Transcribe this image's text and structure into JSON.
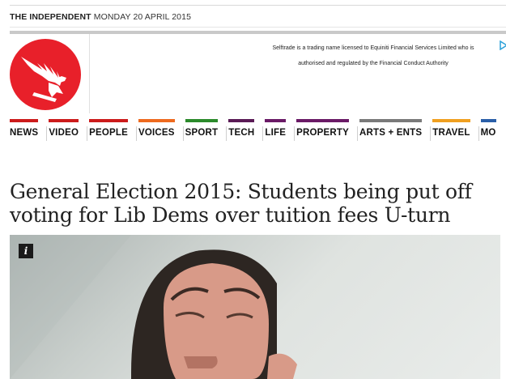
{
  "header": {
    "brand": "THE INDEPENDENT",
    "date": "MONDAY 20 APRIL 2015"
  },
  "logo": {
    "icon": "eagle-icon",
    "color": "#e8202a"
  },
  "advert": {
    "line1": "Selftrade is a trading name licensed to Equiniti Financial Services Limited who is",
    "line2": "authorised and regulated by the Financial Conduct Authority",
    "icon": "adchoices-icon"
  },
  "nav": {
    "items": [
      {
        "label": "NEWS",
        "color": "#cc1b1b"
      },
      {
        "label": "VIDEO",
        "color": "#cc1b1b"
      },
      {
        "label": "PEOPLE",
        "color": "#cc1b1b"
      },
      {
        "label": "VOICES",
        "color": "#ee6a1f"
      },
      {
        "label": "SPORT",
        "color": "#2b8a2b"
      },
      {
        "label": "TECH",
        "color": "#5a1a55"
      },
      {
        "label": "LIFE",
        "color": "#6a1a66"
      },
      {
        "label": "PROPERTY",
        "color": "#6a1a66"
      },
      {
        "label": "ARTS + ENTS",
        "color": "#7a7a7a"
      },
      {
        "label": "TRAVEL",
        "color": "#f0a020"
      },
      {
        "label": "MO",
        "color": "#2a5fa8"
      }
    ]
  },
  "article": {
    "headline": "General Election 2015: Students being put off voting for Lib Dems over tuition fees U-turn",
    "image_info_label": "i"
  }
}
